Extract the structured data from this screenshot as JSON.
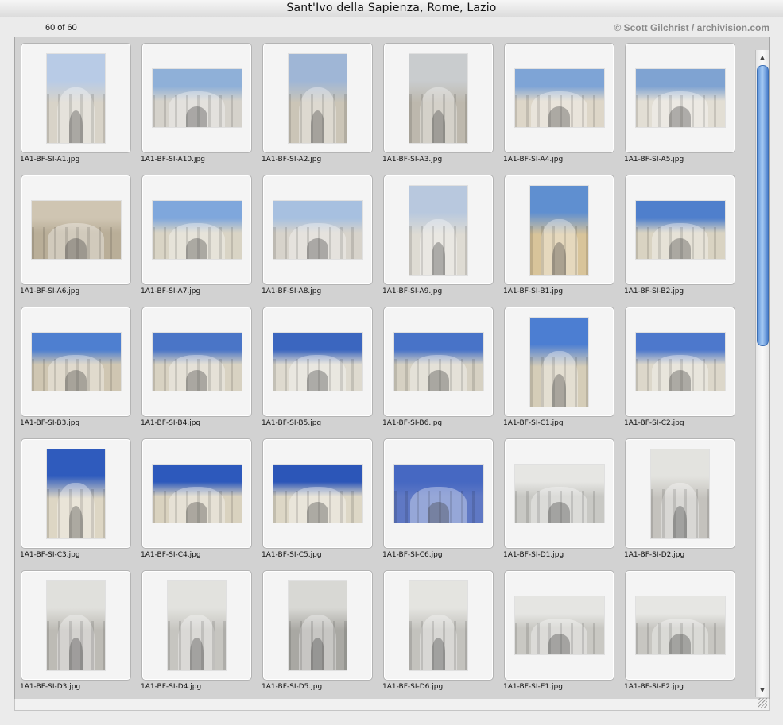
{
  "window": {
    "title": "Sant'Ivo della Sapienza, Rome, Lazio"
  },
  "info": {
    "count": "60 of 60",
    "copyright": "© Scott Gilchrist / archivision.com"
  },
  "thumbnails": [
    {
      "label": "1A1-BF-SI-A1.jpg",
      "o": "p",
      "sky": "#b8cbe6",
      "bld": "#d8d3c8"
    },
    {
      "label": "1A1-BF-SI-A10.jpg",
      "o": "l",
      "sky": "#8fb0d8",
      "bld": "#d5d2cb"
    },
    {
      "label": "1A1-BF-SI-A2.jpg",
      "o": "p",
      "sky": "#9fb6d6",
      "bld": "#cbc5b7"
    },
    {
      "label": "1A1-BF-SI-A3.jpg",
      "o": "p",
      "sky": "#c9ccce",
      "bld": "#bdb8ad"
    },
    {
      "label": "1A1-BF-SI-A4.jpg",
      "o": "l",
      "sky": "#7ea4d6",
      "bld": "#ddd6c8"
    },
    {
      "label": "1A1-BF-SI-A5.jpg",
      "o": "l",
      "sky": "#7fa3d2",
      "bld": "#e2ded4"
    },
    {
      "label": "1A1-BF-SI-A6.jpg",
      "o": "l",
      "sky": "#cfc5b2",
      "bld": "#b9ae98"
    },
    {
      "label": "1A1-BF-SI-A7.jpg",
      "o": "l",
      "sky": "#7fa7dc",
      "bld": "#d9d4c5"
    },
    {
      "label": "1A1-BF-SI-A8.jpg",
      "o": "l",
      "sky": "#a7c0e0",
      "bld": "#d7d3cb"
    },
    {
      "label": "1A1-BF-SI-A9.jpg",
      "o": "p",
      "sky": "#b8c8de",
      "bld": "#dedbd3"
    },
    {
      "label": "1A1-BF-SI-B1.jpg",
      "o": "p",
      "sky": "#5f8fd0",
      "bld": "#d8c49a"
    },
    {
      "label": "1A1-BF-SI-B2.jpg",
      "o": "l",
      "sky": "#4f7fcc",
      "bld": "#d9d3c2"
    },
    {
      "label": "1A1-BF-SI-B3.jpg",
      "o": "l",
      "sky": "#4e7fd0",
      "bld": "#cfc6b2"
    },
    {
      "label": "1A1-BF-SI-B4.jpg",
      "o": "l",
      "sky": "#4a75c7",
      "bld": "#d8d2c2"
    },
    {
      "label": "1A1-BF-SI-B5.jpg",
      "o": "l",
      "sky": "#3b66bf",
      "bld": "#dedacf"
    },
    {
      "label": "1A1-BF-SI-B6.jpg",
      "o": "l",
      "sky": "#4873c8",
      "bld": "#d6d1c3"
    },
    {
      "label": "1A1-BF-SI-C1.jpg",
      "o": "p",
      "sky": "#4c7ed2",
      "bld": "#d5cdb8"
    },
    {
      "label": "1A1-BF-SI-C2.jpg",
      "o": "l",
      "sky": "#4d78cc",
      "bld": "#dcd7ca"
    },
    {
      "label": "1A1-BF-SI-C3.jpg",
      "o": "p",
      "sky": "#2f5bbd",
      "bld": "#ddd6c4"
    },
    {
      "label": "1A1-BF-SI-C4.jpg",
      "o": "l",
      "sky": "#2d59bc",
      "bld": "#d9d2bf"
    },
    {
      "label": "1A1-BF-SI-C5.jpg",
      "o": "l",
      "sky": "#2c56b8",
      "bld": "#ddd7c6"
    },
    {
      "label": "1A1-BF-SI-C6.jpg",
      "o": "l",
      "sky": "#4668c2",
      "bld": "#5f78c4"
    },
    {
      "label": "1A1-BF-SI-D1.jpg",
      "o": "l",
      "sky": "#e6e6e3",
      "bld": "#c8c8c4"
    },
    {
      "label": "1A1-BF-SI-D2.jpg",
      "o": "p",
      "sky": "#e3e3df",
      "bld": "#c4c2bd"
    },
    {
      "label": "1A1-BF-SI-D3.jpg",
      "o": "p",
      "sky": "#e0e0dc",
      "bld": "#bdbbb5"
    },
    {
      "label": "1A1-BF-SI-D4.jpg",
      "o": "p",
      "sky": "#e2e2de",
      "bld": "#c6c5c0"
    },
    {
      "label": "1A1-BF-SI-D5.jpg",
      "o": "p",
      "sky": "#d8d8d4",
      "bld": "#a9a8a3"
    },
    {
      "label": "1A1-BF-SI-D6.jpg",
      "o": "p",
      "sky": "#e4e4e0",
      "bld": "#c3c2bd"
    },
    {
      "label": "1A1-BF-SI-E1.jpg",
      "o": "l",
      "sky": "#e5e5e2",
      "bld": "#c9c8c3"
    },
    {
      "label": "1A1-BF-SI-E2.jpg",
      "o": "l",
      "sky": "#e6e6e3",
      "bld": "#c7c6c1"
    }
  ],
  "scrollbar": {
    "up_icon": "triangle-up-icon",
    "down_icon": "triangle-down-icon"
  }
}
